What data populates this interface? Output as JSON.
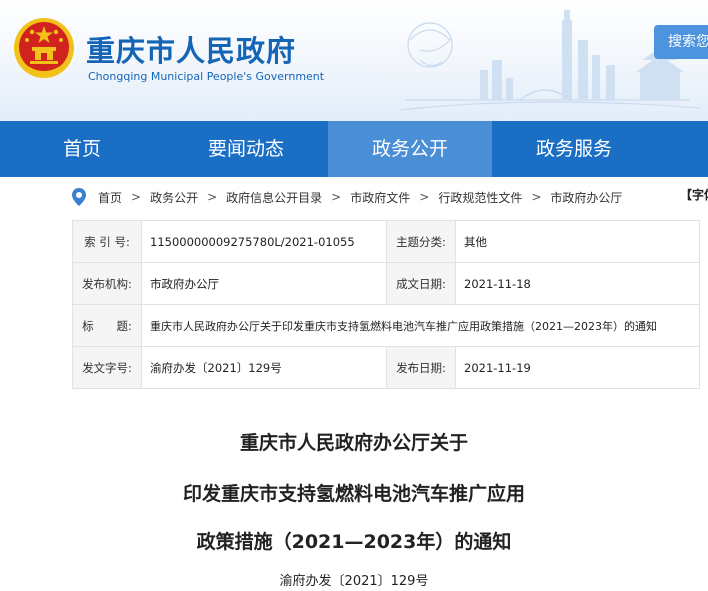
{
  "header": {
    "site_title": "重庆市人民政府",
    "site_subtitle": "Chongqing Municipal People's Government",
    "search_label": "搜索您",
    "colors": {
      "primary": "#1565b6",
      "nav": "#1a6fc4",
      "nav_active": "#4a8fd6",
      "emblem_red": "#d2221d",
      "emblem_gold": "#f2c21b"
    }
  },
  "nav": {
    "items": [
      {
        "label": "首页"
      },
      {
        "label": "要闻动态"
      },
      {
        "label": "政务公开",
        "active": true
      },
      {
        "label": "政务服务"
      }
    ]
  },
  "breadcrumb": {
    "items": [
      "首页",
      "政务公开",
      "政府信息公开目录",
      "市政府文件",
      "行政规范性文件",
      "市政府办公厅"
    ],
    "separator": ">",
    "font_size_label": "【字体"
  },
  "meta": {
    "index_label": "索 引 号:",
    "index_value": "11500000009275780L/2021-01055",
    "category_label": "主题分类:",
    "category_value": "其他",
    "publisher_label": "发布机构:",
    "publisher_value": "市政府办公厅",
    "created_label": "成文日期:",
    "created_value": "2021-11-18",
    "title_label": "标　　题:",
    "title_value": "重庆市人民政府办公厅关于印发重庆市支持氢燃料电池汽车推广应用政策措施（2021—2023年）的通知",
    "docno_label": "发文字号:",
    "docno_value": "渝府办发〔2021〕129号",
    "published_label": "发布日期:",
    "published_value": "2021-11-19"
  },
  "document": {
    "title_line1": "重庆市人民政府办公厅关于",
    "title_line2": "印发重庆市支持氢燃料电池汽车推广应用",
    "title_line3": "政策措施（2021—2023年）的通知",
    "doc_number": "渝府办发〔2021〕129号"
  }
}
